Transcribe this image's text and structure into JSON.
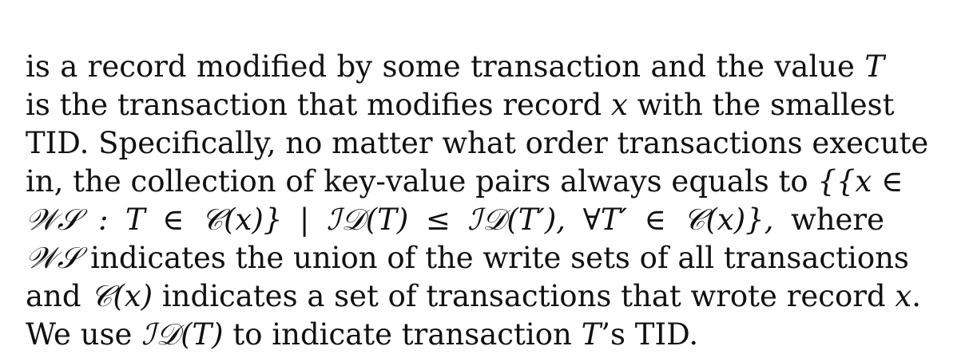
{
  "paragraph": {
    "lines": [
      [
        {
          "t": "is a record modified by some transaction and the value ",
          "k": "text"
        },
        {
          "t": "T",
          "k": "math"
        }
      ],
      [
        {
          "t": "is the transaction that modifies record ",
          "k": "text"
        },
        {
          "t": "x",
          "k": "math"
        },
        {
          "t": " with the smallest",
          "k": "text"
        }
      ],
      [
        {
          "t": "TID. Specifically, no matter what order transactions execute",
          "k": "text"
        }
      ],
      [
        {
          "t": "in, the collection of key-value pairs always equals to ",
          "k": "text"
        },
        {
          "t": "{{x ∈",
          "k": "math"
        }
      ],
      [
        {
          "t": "𝒲𝒮",
          "k": "cal"
        },
        {
          "t": " : T ∈ ",
          "k": "math"
        },
        {
          "t": "𝒞",
          "k": "cal"
        },
        {
          "t": "(x)} | ",
          "k": "math"
        },
        {
          "t": "ℐ𝒟",
          "k": "cal"
        },
        {
          "t": "(T) ≤ ",
          "k": "math"
        },
        {
          "t": "ℐ𝒟",
          "k": "cal"
        },
        {
          "t": "(T′), ∀T′ ∈ ",
          "k": "math"
        },
        {
          "t": "𝒞",
          "k": "cal"
        },
        {
          "t": "(x)},",
          "k": "math"
        },
        {
          "t": " where",
          "k": "text"
        }
      ],
      [
        {
          "t": "𝒲𝒮",
          "k": "cal"
        },
        {
          "t": " indicates the union of the write sets of all transactions",
          "k": "text"
        }
      ],
      [
        {
          "t": "and ",
          "k": "text"
        },
        {
          "t": "𝒞",
          "k": "cal"
        },
        {
          "t": "(x)",
          "k": "math"
        },
        {
          "t": " indicates a set of transactions that wrote record ",
          "k": "text"
        },
        {
          "t": "x",
          "k": "math"
        },
        {
          "t": ".",
          "k": "text"
        }
      ],
      [
        {
          "t": "We use ",
          "k": "text"
        },
        {
          "t": "ℐ𝒟",
          "k": "cal"
        },
        {
          "t": "(T)",
          "k": "math"
        },
        {
          "t": " to indicate transaction ",
          "k": "text"
        },
        {
          "t": "T",
          "k": "math"
        },
        {
          "t": "’s TID.",
          "k": "text"
        }
      ]
    ]
  }
}
